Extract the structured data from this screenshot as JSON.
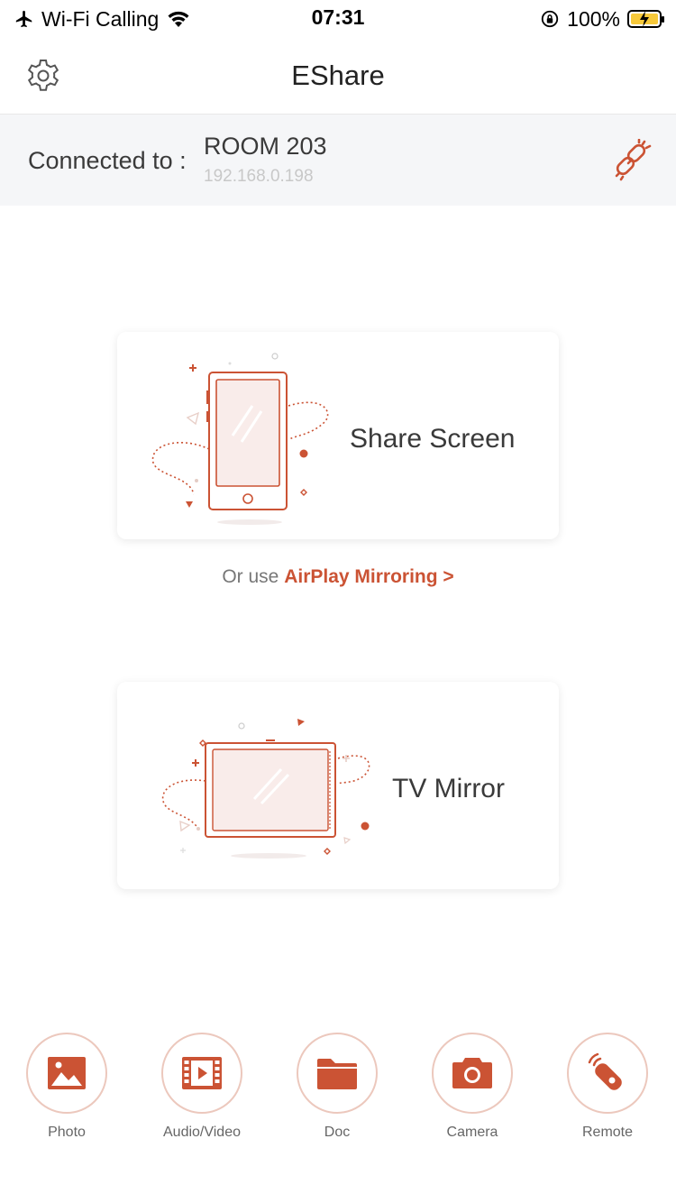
{
  "status": {
    "carrier": "Wi-Fi Calling",
    "time": "07:31",
    "battery": "100%"
  },
  "nav": {
    "title": "EShare"
  },
  "connection": {
    "label": "Connected to :",
    "room": "ROOM 203",
    "ip": "192.168.0.198"
  },
  "cards": {
    "share_screen": "Share Screen",
    "tv_mirror": "TV Mirror"
  },
  "airplay": {
    "prefix": "Or use",
    "link": "AirPlay Mirroring >"
  },
  "toolbar": {
    "photo": "Photo",
    "audio_video": "Audio/Video",
    "doc": "Doc",
    "camera": "Camera",
    "remote": "Remote"
  },
  "colors": {
    "accent": "#cb5334",
    "accent_light": "#ecc8bd",
    "bar_bg": "#f5f6f8"
  }
}
